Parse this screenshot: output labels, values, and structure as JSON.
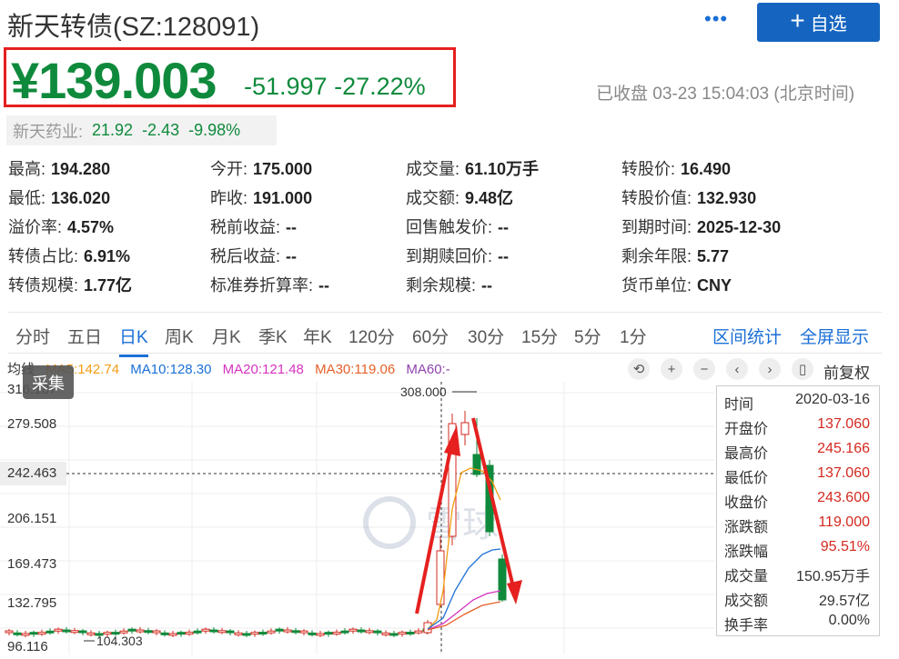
{
  "header": {
    "title": "新天转债(SZ:128091)",
    "more_label": "•••",
    "add_label": "自选",
    "price": "¥139.003",
    "change": "-51.997",
    "change_pct": "-27.22%",
    "status": "已收盘 03-23 15:04:03 (北京时间)"
  },
  "stock": {
    "name": "新天药业:",
    "price": "21.92",
    "change": "-2.43",
    "change_pct": "-9.98%"
  },
  "stats": [
    {
      "k": "最高:",
      "v": "194.280"
    },
    {
      "k": "今开:",
      "v": "175.000"
    },
    {
      "k": "成交量:",
      "v": "61.10万手"
    },
    {
      "k": "转股价:",
      "v": "16.490"
    },
    {
      "k": "最低:",
      "v": "136.020"
    },
    {
      "k": "昨收:",
      "v": "191.000"
    },
    {
      "k": "成交额:",
      "v": "9.48亿"
    },
    {
      "k": "转股价值:",
      "v": "132.930"
    },
    {
      "k": "溢价率:",
      "v": "4.57%"
    },
    {
      "k": "税前收益:",
      "v": "--"
    },
    {
      "k": "回售触发价:",
      "v": "--"
    },
    {
      "k": "到期时间:",
      "v": "2025-12-30"
    },
    {
      "k": "转债占比:",
      "v": "6.91%"
    },
    {
      "k": "税后收益:",
      "v": "--"
    },
    {
      "k": "到期赎回价:",
      "v": "--"
    },
    {
      "k": "剩余年限:",
      "v": "5.77"
    },
    {
      "k": "转债规模:",
      "v": "1.77亿"
    },
    {
      "k": "标准券折算率:",
      "v": "--"
    },
    {
      "k": "剩余规模:",
      "v": "--"
    },
    {
      "k": "货币单位:",
      "v": "CNY"
    }
  ],
  "tabs": [
    "分时",
    "五日",
    "日K",
    "周K",
    "月K",
    "季K",
    "年K",
    "120分",
    "60分",
    "30分",
    "15分",
    "5分",
    "1分"
  ],
  "tabs_right": [
    "区间统计",
    "全屏显示"
  ],
  "ma": {
    "prefix": "均线",
    "ma5": "MA5:142.74",
    "ma10": "MA10:128.30",
    "ma20": "MA20:121.48",
    "ma30": "MA30:119.06",
    "ma60": "MA60:-"
  },
  "toolbar": {
    "fuquan": "前复权",
    "caiji": "采集"
  },
  "chart_data": {
    "type": "candlestick",
    "y_ticks": [
      "316.187",
      "279.508",
      "242.463",
      "206.151",
      "169.473",
      "132.795",
      "96.116"
    ],
    "high_label": "308.000",
    "low_label": "104.303",
    "crosshair_y": "242.463",
    "watermark": "雪球",
    "ylim": [
      96.116,
      316.187
    ]
  },
  "tooltip": [
    {
      "k": "时间",
      "v": "2020-03-16",
      "c": "dark"
    },
    {
      "k": "开盘价",
      "v": "137.060",
      "c": "red"
    },
    {
      "k": "最高价",
      "v": "245.166",
      "c": "red"
    },
    {
      "k": "最低价",
      "v": "137.060",
      "c": "red"
    },
    {
      "k": "收盘价",
      "v": "243.600",
      "c": "red"
    },
    {
      "k": "涨跌额",
      "v": "119.000",
      "c": "red"
    },
    {
      "k": "涨跌幅",
      "v": "95.51%",
      "c": "red"
    },
    {
      "k": "成交量",
      "v": "150.95万手",
      "c": "dark"
    },
    {
      "k": "成交额",
      "v": "29.57亿",
      "c": "dark"
    },
    {
      "k": "换手率",
      "v": "0.00%",
      "c": "dark"
    }
  ]
}
